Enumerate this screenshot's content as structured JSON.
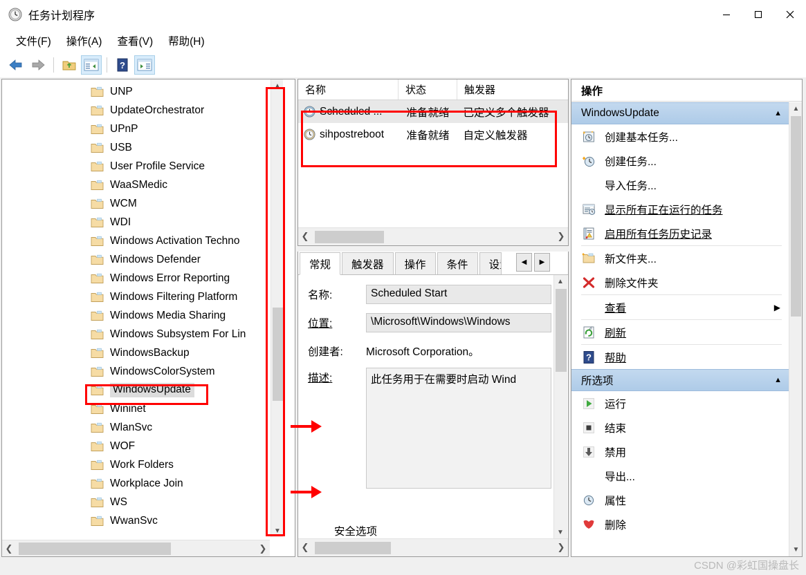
{
  "window": {
    "title": "任务计划程序",
    "icon": "clock-icon",
    "minimize": "–",
    "maximize": "□",
    "close": "✕"
  },
  "menubar": {
    "items": [
      {
        "label": "文件(F)",
        "accel": "F"
      },
      {
        "label": "操作(A)",
        "accel": "A"
      },
      {
        "label": "查看(V)",
        "accel": "V"
      },
      {
        "label": "帮助(H)",
        "accel": "H"
      }
    ]
  },
  "toolbar": {
    "buttons": [
      {
        "name": "back-icon",
        "selected": false
      },
      {
        "name": "forward-icon",
        "selected": false
      },
      {
        "name": "folder-up-icon",
        "selected": false
      },
      {
        "name": "show-console-tree-icon",
        "selected": true
      },
      {
        "name": "help-icon",
        "selected": false
      },
      {
        "name": "show-action-pane-icon",
        "selected": true
      }
    ]
  },
  "tree": {
    "items": [
      {
        "label": "UNP",
        "selected": false
      },
      {
        "label": "UpdateOrchestrator",
        "selected": false
      },
      {
        "label": "UPnP",
        "selected": false
      },
      {
        "label": "USB",
        "selected": false
      },
      {
        "label": "User Profile Service",
        "selected": false
      },
      {
        "label": "WaaSMedic",
        "selected": false
      },
      {
        "label": "WCM",
        "selected": false
      },
      {
        "label": "WDI",
        "selected": false
      },
      {
        "label": "Windows Activation Techno",
        "selected": false
      },
      {
        "label": "Windows Defender",
        "selected": false
      },
      {
        "label": "Windows Error Reporting",
        "selected": false
      },
      {
        "label": "Windows Filtering Platform",
        "selected": false
      },
      {
        "label": "Windows Media Sharing",
        "selected": false
      },
      {
        "label": "Windows Subsystem For Lin",
        "selected": false
      },
      {
        "label": "WindowsBackup",
        "selected": false
      },
      {
        "label": "WindowsColorSystem",
        "selected": false
      },
      {
        "label": "WindowsUpdate",
        "selected": true
      },
      {
        "label": "Wininet",
        "selected": false
      },
      {
        "label": "WlanSvc",
        "selected": false
      },
      {
        "label": "WOF",
        "selected": false
      },
      {
        "label": "Work Folders",
        "selected": false
      },
      {
        "label": "Workplace Join",
        "selected": false
      },
      {
        "label": "WS",
        "selected": false
      },
      {
        "label": "WwanSvc",
        "selected": false
      }
    ]
  },
  "tasklist": {
    "columns": [
      "名称",
      "状态",
      "触发器"
    ],
    "rows": [
      {
        "name": "Scheduled ...",
        "status": "准备就绪",
        "trigger": "已定义多个触发器",
        "selected": true
      },
      {
        "name": "sihpostreboot",
        "status": "准备就绪",
        "trigger": "自定义触发器",
        "selected": false
      }
    ]
  },
  "details": {
    "tabs": [
      {
        "label": "常规",
        "active": true
      },
      {
        "label": "触发器",
        "active": false
      },
      {
        "label": "操作",
        "active": false
      },
      {
        "label": "条件",
        "active": false
      },
      {
        "label": "设置",
        "active": false
      }
    ],
    "tab_prev": "◀",
    "tab_next": "▶",
    "fields": {
      "name_label": "名称:",
      "name_value": "Scheduled Start",
      "location_label": "位置:",
      "location_value": "\\Microsoft\\Windows\\Windows",
      "author_label": "创建者:",
      "author_value": "Microsoft Corporation。",
      "description_label": "描述:",
      "description_value": "此任务用于在需要时启动 Wind"
    },
    "security_section": "安全选项"
  },
  "actions": {
    "title": "操作",
    "groups": [
      {
        "header": "WindowsUpdate",
        "caret": "▲",
        "items": [
          {
            "label": "创建基本任务...",
            "icon": "create-basic-task-icon",
            "underline": false,
            "submenu": ""
          },
          {
            "label": "创建任务...",
            "icon": "create-task-icon",
            "underline": false,
            "submenu": ""
          },
          {
            "label": "导入任务...",
            "icon": "",
            "underline": false,
            "submenu": ""
          },
          {
            "label": "显示所有正在运行的任务",
            "icon": "running-tasks-icon",
            "underline": true,
            "submenu": ""
          },
          {
            "label": "启用所有任务历史记录",
            "icon": "task-history-icon",
            "underline": true,
            "submenu": ""
          },
          {
            "label": "新文件夹...",
            "icon": "new-folder-icon",
            "underline": false,
            "submenu": ""
          },
          {
            "label": "删除文件夹",
            "icon": "delete-folder-icon",
            "underline": false,
            "submenu": ""
          },
          {
            "label": "查看",
            "icon": "",
            "underline": true,
            "submenu": "▶"
          },
          {
            "label": "刷新",
            "icon": "refresh-icon",
            "underline": true,
            "submenu": ""
          },
          {
            "label": "帮助",
            "icon": "help-icon",
            "underline": true,
            "submenu": ""
          }
        ]
      },
      {
        "header": "所选项",
        "caret": "▲",
        "items": [
          {
            "label": "运行",
            "icon": "run-icon",
            "underline": false,
            "submenu": ""
          },
          {
            "label": "结束",
            "icon": "end-icon",
            "underline": false,
            "submenu": ""
          },
          {
            "label": "禁用",
            "icon": "disable-icon",
            "underline": false,
            "submenu": ""
          },
          {
            "label": "导出...",
            "icon": "",
            "underline": false,
            "submenu": ""
          },
          {
            "label": "属性",
            "icon": "properties-icon",
            "underline": false,
            "submenu": ""
          },
          {
            "label": "删除",
            "icon": "delete-icon",
            "underline": false,
            "submenu": ""
          }
        ]
      }
    ]
  },
  "watermark": "CSDN @彩虹国操盘长",
  "colors": {
    "accent_header": "#aecbe8",
    "annotation": "#ff0000",
    "selection": "#dcdcdc"
  }
}
